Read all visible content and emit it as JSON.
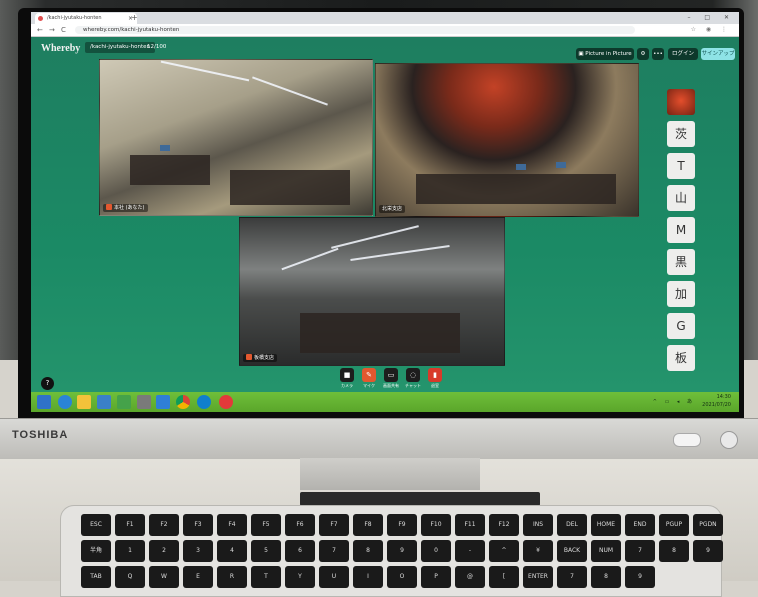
{
  "browser": {
    "tab_title": "/kachi-jyutaku-honten",
    "url": "whereby.com/kachi-jyutaku-honten",
    "nav_back": "←",
    "nav_forward": "→",
    "nav_reload": "C",
    "new_tab": "+",
    "window_controls": "– □ ✕"
  },
  "app": {
    "logo": "Whereby",
    "room_name": "/kachi-jyutaku-honten",
    "room_count": "12/100",
    "pip_label": "Picture in Picture",
    "login_label": "ログイン",
    "signup_label": "サインアップ",
    "settings_icon": "⚙",
    "more_icon": "•••",
    "help_label": "?"
  },
  "participants": [
    {
      "name": "本社 (あなた)"
    },
    {
      "name": "北栄支店"
    },
    {
      "name": "板橋支店"
    }
  ],
  "side_panel": {
    "chips": [
      "茨",
      "T",
      "山",
      "M",
      "黒",
      "加",
      "G",
      "板"
    ]
  },
  "controls": [
    {
      "label": "カメラ",
      "icon": "■"
    },
    {
      "label": "マイク",
      "icon": "✎"
    },
    {
      "label": "画面共有",
      "icon": "▭"
    },
    {
      "label": "チャット",
      "icon": "◌"
    },
    {
      "label": "退室",
      "icon": "▮"
    }
  ],
  "taskbar": {
    "time": "14:30",
    "date": "2021/07/20"
  },
  "device": {
    "brand": "TOSHIBA"
  },
  "keyboard": {
    "row1": [
      "ESC",
      "F1",
      "F2",
      "F3",
      "F4",
      "F5",
      "F6",
      "F7",
      "F8",
      "F9",
      "F10",
      "F11",
      "F12",
      "INS",
      "DEL",
      "HOME",
      "END",
      "PGUP",
      "PGDN"
    ],
    "row2": [
      "半角",
      "1",
      "2",
      "3",
      "4",
      "5",
      "6",
      "7",
      "8",
      "9",
      "0",
      "-",
      "^",
      "¥",
      "BACK SPACE",
      "NUM LOCK",
      "7",
      "8",
      "9"
    ],
    "row3": [
      "TAB",
      "Q",
      "W",
      "E",
      "R",
      "T",
      "Y",
      "U",
      "I",
      "O",
      "P",
      "@",
      "[",
      "ENTER",
      "7",
      "8",
      "9"
    ]
  },
  "colors": {
    "app_bg": "#1e7e60",
    "accent": "#8ee3e6",
    "taskbar": "#5aa62a",
    "mic_off": "#e3582f"
  }
}
